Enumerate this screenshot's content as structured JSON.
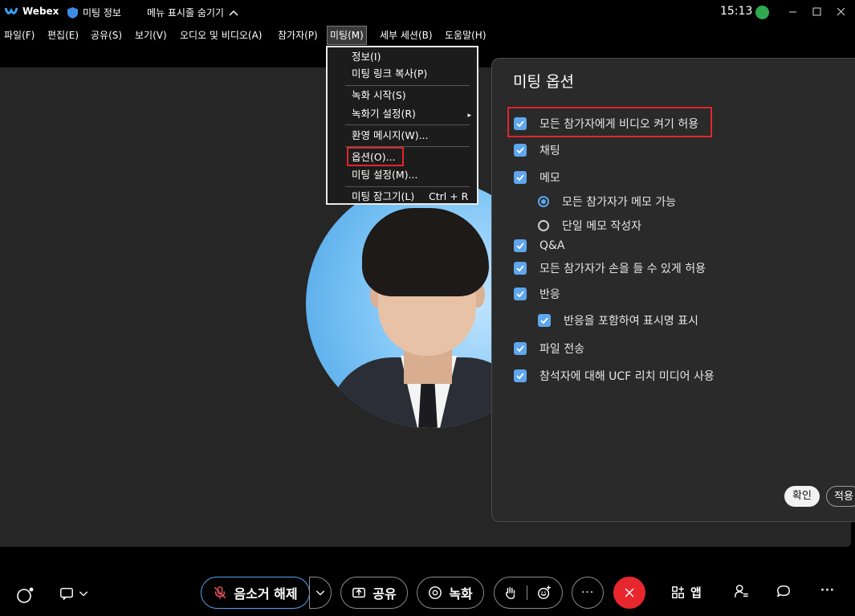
{
  "titlebar": {
    "app_name": "Webex",
    "meeting_info": "미팅 정보",
    "hide_menu": "메뉴 표시줄 숨기기",
    "time": "15:13"
  },
  "menubar": [
    {
      "label": "파일(F)"
    },
    {
      "label": "편집(E)"
    },
    {
      "label": "공유(S)"
    },
    {
      "label": "보기(V)"
    },
    {
      "label": "오디오 및 비디오(A)"
    },
    {
      "label": "참가자(P)"
    },
    {
      "label": "미팅(M)"
    },
    {
      "label": "세부 세션(B)"
    },
    {
      "label": "도움말(H)"
    }
  ],
  "meeting_menu": {
    "info": "정보(I)",
    "copy_link": "미팅 링크 복사(P)",
    "start_recording": "녹화 시작(S)",
    "recorder_settings": "녹화기 설정(R)",
    "welcome_message": "환영 메시지(W)...",
    "options": "옵션(O)...",
    "meeting_settings": "미팅 설정(M)...",
    "lock_meeting": "미팅 잠그기(L)",
    "lock_shortcut": "Ctrl + R"
  },
  "options_panel": {
    "title": "미팅 옵션",
    "items": [
      {
        "label": "모든 참가자에게 비디오 켜기 허용",
        "checked": true
      },
      {
        "label": "채팅",
        "checked": true
      },
      {
        "label": "메모",
        "checked": true
      },
      {
        "label": "모든 참가자가 메모 가능",
        "selected": true
      },
      {
        "label": "단일 메모 작성자",
        "selected": false
      },
      {
        "label": "Q&A",
        "checked": true
      },
      {
        "label": "모든 참가자가 손을 들 수 있게 허용",
        "checked": true
      },
      {
        "label": "반응",
        "checked": true
      },
      {
        "label": "반응을 포함하여 표시명 표시",
        "checked": true
      },
      {
        "label": "파일 전송",
        "checked": true
      },
      {
        "label": "참석자에 대해 UCF 리치 미디어 사용",
        "checked": true
      }
    ],
    "ok_label": "확인",
    "apply_label": "적용"
  },
  "toolbar": {
    "unmute": "음소거 해제",
    "share": "공유",
    "record": "녹화",
    "apps": "앱"
  },
  "colors": {
    "accent": "#5ea6ee",
    "highlight": "#e0262b",
    "end_call": "#e8262d"
  }
}
